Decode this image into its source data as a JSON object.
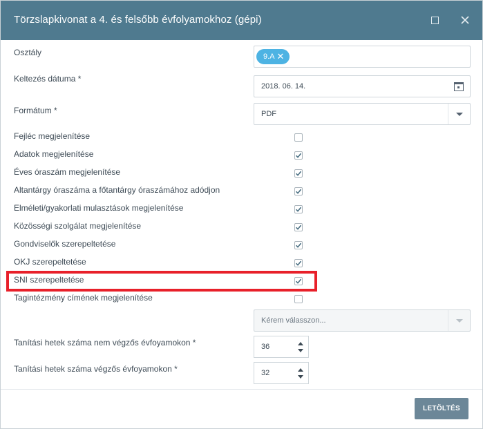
{
  "dialog": {
    "title": "Törzslapkivonat a 4. és felsőbb évfolyamokhoz (gépi)",
    "maximize_icon": "maximize-icon",
    "close_icon": "close-icon"
  },
  "form": {
    "class_label": "Osztály",
    "class_chip": "9.A",
    "date_label": "Keltezés dátuma *",
    "date_value": "2018. 06. 14.",
    "format_label": "Formátum *",
    "format_value": "PDF",
    "checkboxes": [
      {
        "label": "Fejléc megjelenítése",
        "checked": false
      },
      {
        "label": "Adatok megjelenítése",
        "checked": true
      },
      {
        "label": "Éves óraszám megjelenítése",
        "checked": true
      },
      {
        "label": "Altantárgy óraszáma a főtantárgy óraszámához adódjon",
        "checked": true
      },
      {
        "label": "Elméleti/gyakorlati mulasztások megjelenítése",
        "checked": true
      },
      {
        "label": "Közösségi szolgálat megjelenítése",
        "checked": true
      },
      {
        "label": "Gondviselők szerepeltetése",
        "checked": true
      },
      {
        "label": "OKJ szerepeltetése",
        "checked": true
      },
      {
        "label": "SNI szerepeltetése",
        "checked": true
      },
      {
        "label": "Tagintézmény címének megjelenítése",
        "checked": false
      }
    ],
    "institution_placeholder": "Kérem válasszon...",
    "weeks_nonfinal_label": "Tanítási hetek száma nem végzős évfoyamokon *",
    "weeks_nonfinal_value": "36",
    "weeks_final_label": "Tanítási hetek száma végzős évfoyamokon *",
    "weeks_final_value": "32"
  },
  "footer": {
    "download_label": "LETÖLTÉS"
  },
  "colors": {
    "titlebar": "#4f7a8f",
    "chip": "#4db3e3",
    "highlight": "#e8202a",
    "button": "#6c8798"
  }
}
